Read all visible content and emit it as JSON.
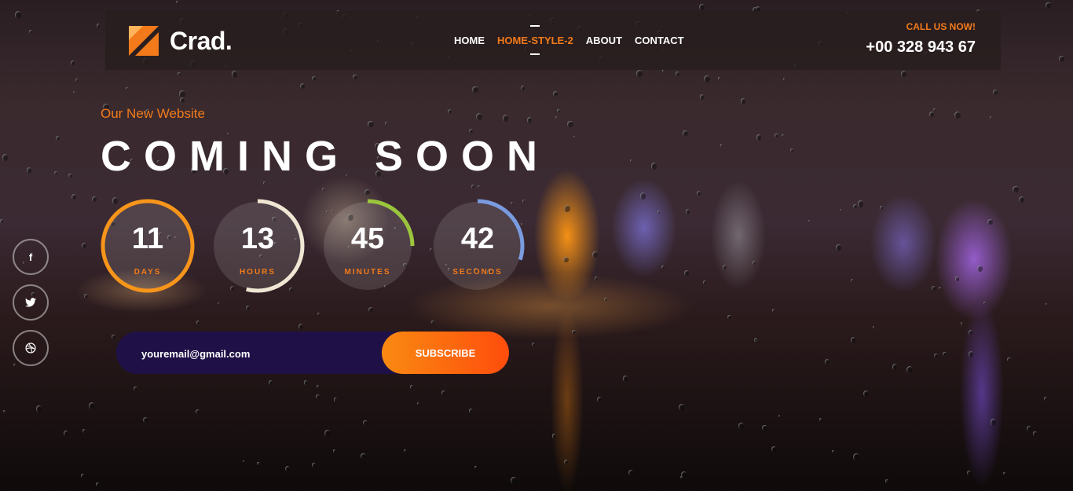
{
  "brand": {
    "name": "Crad.",
    "accent": "#f27a1a"
  },
  "nav": {
    "items": [
      {
        "label": "HOME"
      },
      {
        "label": "HOME-STYLE-2"
      },
      {
        "label": "ABOUT"
      },
      {
        "label": "CONTACT"
      }
    ],
    "active": "HOME-STYLE-2"
  },
  "call": {
    "label": "CALL US NOW!",
    "number": "+00 328 943 67"
  },
  "hero": {
    "tagline": "Our New Website",
    "title": "COMING SOON"
  },
  "countdown": [
    {
      "value": "11",
      "label": "DAYS",
      "progress": 1.0,
      "color": "#f7951b"
    },
    {
      "value": "13",
      "label": "HOURS",
      "progress": 0.54,
      "color": "#efe7d4"
    },
    {
      "value": "45",
      "label": "MINUTES",
      "progress": 0.25,
      "color": "#9bc53d"
    },
    {
      "value": "42",
      "label": "SECONDS",
      "progress": 0.3,
      "color": "#7a9be0"
    }
  ],
  "social": [
    {
      "icon": "facebook-icon",
      "glyph": "f"
    },
    {
      "icon": "twitter-icon",
      "glyph": "🐦"
    },
    {
      "icon": "dribbble-icon",
      "glyph": "◎"
    }
  ],
  "subscribe": {
    "email_value": "youremail@gmail.com",
    "button_label": "SUBSCRIBE"
  }
}
